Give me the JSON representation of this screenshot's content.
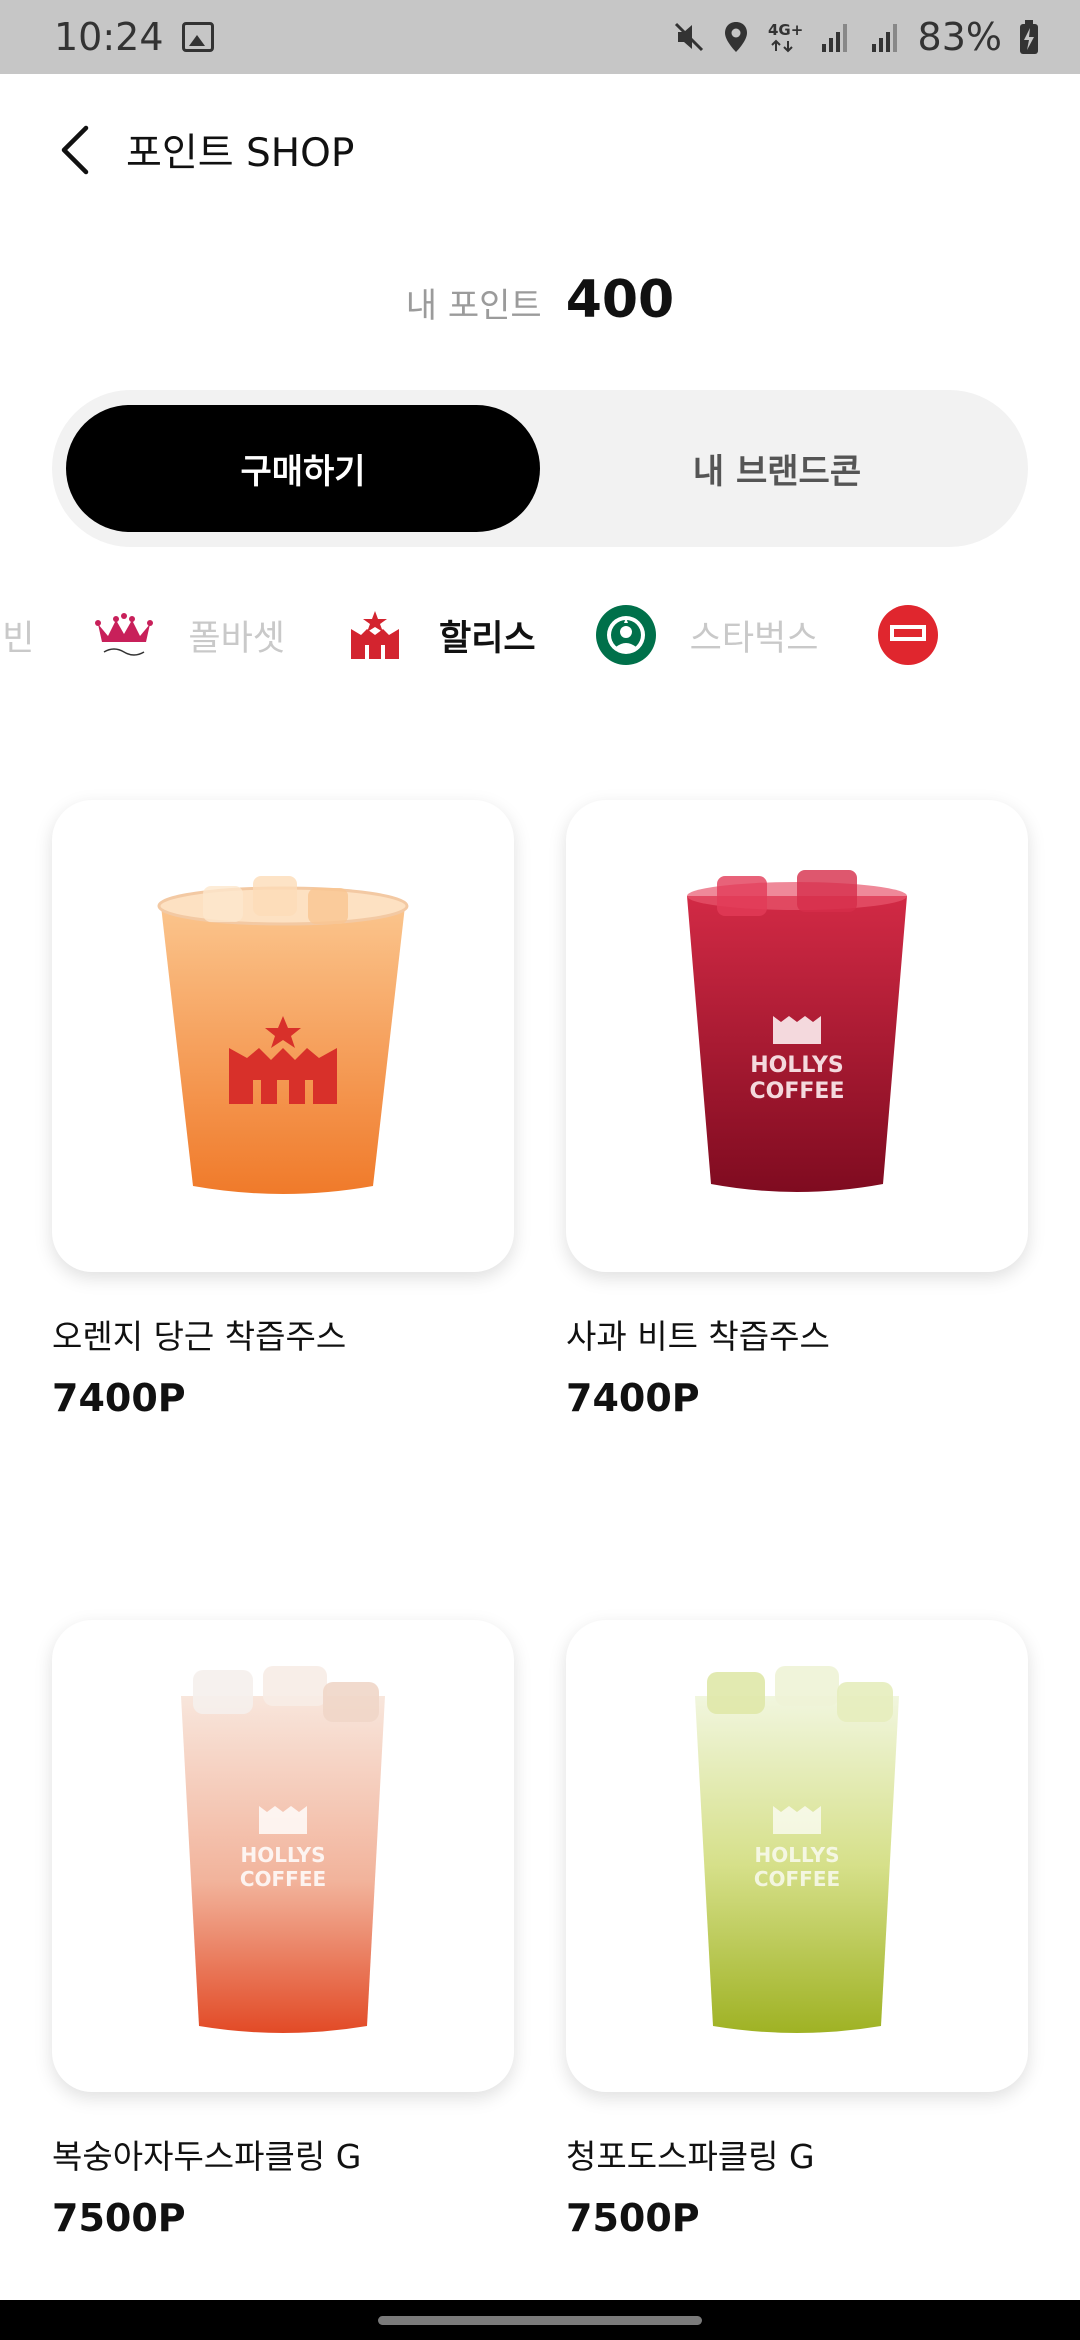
{
  "status_bar": {
    "time": "10:24",
    "battery": "83%",
    "icons": [
      "gallery-icon",
      "mute-icon",
      "location-icon",
      "network-4g-icon",
      "signal-icon",
      "battery-charging-icon"
    ],
    "network_label": "4G+"
  },
  "header": {
    "title": "포인트 SHOP",
    "back_icon": "chevron-left-icon"
  },
  "points": {
    "label": "내 포인트",
    "value": "400"
  },
  "segment": {
    "buy_label": "구매하기",
    "my_brandcon_label": "내 브랜드콘",
    "active": "buy"
  },
  "brands": [
    {
      "name": "피빈",
      "logo": null
    },
    {
      "name": "폴바셋",
      "logo": "paul-bassett-crown-logo"
    },
    {
      "name": "할리스",
      "logo": "hollys-crown-logo",
      "selected": true
    },
    {
      "name": "스타벅스",
      "logo": "starbucks-siren-logo"
    },
    {
      "name": "",
      "logo": "partial-red-brand-logo"
    }
  ],
  "products": [
    {
      "name": "오렌지 당근 착즙주스",
      "price": "7400P",
      "image": "orange-carrot-juice-cup",
      "colors": {
        "top": "#f9b070",
        "bottom": "#f07a2a"
      }
    },
    {
      "name": "사과 비트 착즙주스",
      "price": "7400P",
      "image": "apple-beet-juice-glass",
      "colors": {
        "top": "#c21a37",
        "bottom": "#8e0d24"
      }
    },
    {
      "name": "복숭아자두스파클링 G",
      "price": "7500P",
      "image": "peach-plum-sparkling-glass",
      "colors": {
        "top": "#f6d8c8",
        "bottom": "#e9512f"
      }
    },
    {
      "name": "청포도스파클링 G",
      "price": "7500P",
      "image": "green-grape-sparkling-glass",
      "colors": {
        "top": "#e9f1c4",
        "bottom": "#a8bb2a"
      }
    }
  ],
  "cup_brand_text": [
    "HOLLYS",
    "COFFEE"
  ],
  "colors": {
    "accent": "#000000",
    "hollys_red": "#d3242f",
    "starbucks_green": "#00704a",
    "inactive_text": "#c9c9c9"
  }
}
